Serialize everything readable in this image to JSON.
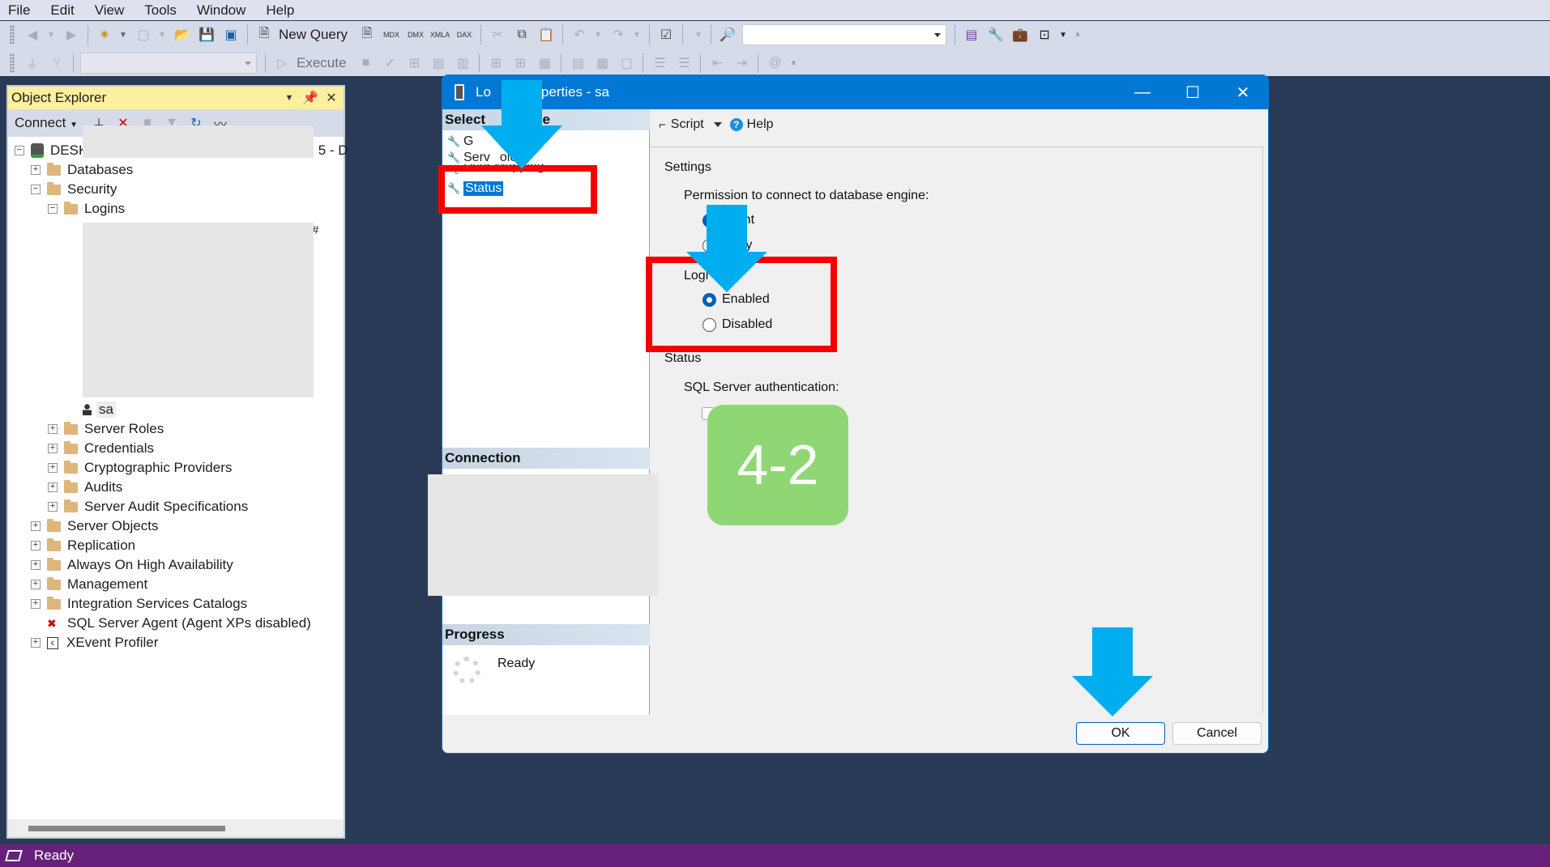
{
  "menu": [
    "File",
    "Edit",
    "View",
    "Tools",
    "Window",
    "Help"
  ],
  "toolbar": {
    "new_query_label": "New Query",
    "execute_label": "Execute",
    "solution_combo_value": "",
    "database_combo_value": "",
    "query_icons": [
      "MDX",
      "DMX",
      "XMLA",
      "DAX"
    ]
  },
  "object_explorer": {
    "title": "Object Explorer",
    "connect_label": "Connect",
    "server_node_prefix": "DESKT",
    "server_node_suffix": "5 - D",
    "tree": [
      {
        "label": "Databases",
        "level": 1,
        "expander": "+"
      },
      {
        "label": "Security",
        "level": 1,
        "expander": "−"
      },
      {
        "label": "Logins",
        "level": 2,
        "expander": "−"
      },
      {
        "label": "sa",
        "level": 3,
        "icon": "user"
      },
      {
        "label": "Server Roles",
        "level": 2,
        "expander": "+"
      },
      {
        "label": "Credentials",
        "level": 2,
        "expander": "+"
      },
      {
        "label": "Cryptographic Providers",
        "level": 2,
        "expander": "+"
      },
      {
        "label": "Audits",
        "level": 2,
        "expander": "+"
      },
      {
        "label": "Server Audit Specifications",
        "level": 2,
        "expander": "+"
      },
      {
        "label": "Server Objects",
        "level": 1,
        "expander": "+"
      },
      {
        "label": "Replication",
        "level": 1,
        "expander": "+"
      },
      {
        "label": "Always On High Availability",
        "level": 1,
        "expander": "+"
      },
      {
        "label": "Management",
        "level": 1,
        "expander": "+"
      },
      {
        "label": "Integration Services Catalogs",
        "level": 1,
        "expander": "+"
      },
      {
        "label": "SQL Server Agent (Agent XPs disabled)",
        "level": 1,
        "icon": "agent"
      },
      {
        "label": "XEvent Profiler",
        "level": 1,
        "expander": "+"
      }
    ],
    "login_hash_fragment": "#"
  },
  "dialog": {
    "title_visible_start": "Lo",
    "title_visible_end": "perties - sa",
    "select_page_header_start": "Select",
    "select_page_header_end": "ge",
    "pages": [
      {
        "label_start": "G",
        "label_end": "",
        "selected": false
      },
      {
        "label_start": "Serv",
        "label_end": "oles",
        "selected": false
      },
      {
        "label_start": "User Mapping",
        "label_end": "",
        "selected": false
      },
      {
        "label_start": "Status",
        "label_end": "",
        "selected": true
      }
    ],
    "connection_header": "Connection",
    "progress_header": "Progress",
    "progress_status": "Ready",
    "script_label": "Script",
    "help_label": "Help",
    "settings_label": "Settings",
    "permission_label": "Permission to connect to database engine:",
    "permission_options": [
      {
        "label": "Grant",
        "selected": true
      },
      {
        "label": "Deny",
        "selected": false
      }
    ],
    "login_group_label": "Logi",
    "login_options": [
      {
        "label": "Enabled",
        "selected": true
      },
      {
        "label": "Disabled",
        "selected": false
      }
    ],
    "status_label": "Status",
    "sql_auth_label": "SQL Server authentication:",
    "ok_label": "OK",
    "cancel_label": "Cancel"
  },
  "annotation": {
    "step_badge": "4-2",
    "badge_color": "#8fd775",
    "arrow_color": "#00adef",
    "highlight_color": "#f40000"
  },
  "statusbar": {
    "text": "Ready"
  }
}
